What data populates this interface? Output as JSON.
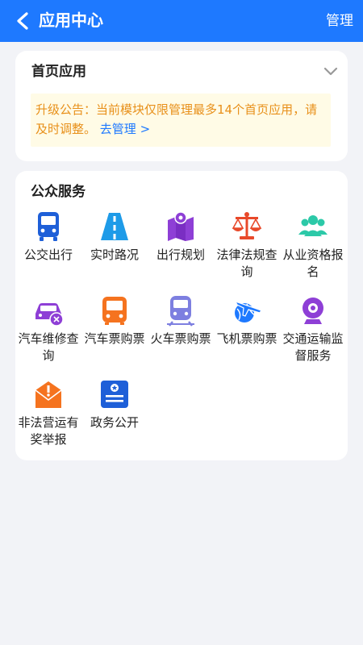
{
  "header": {
    "title": "应用中心",
    "manage_label": "管理"
  },
  "home_apps": {
    "title": "首页应用",
    "notice_text": "升级公告：当前模块仅限管理最多14个首页应用，请及时调整。",
    "notice_link": "去管理 >"
  },
  "public_services": {
    "title": "公众服务",
    "apps": [
      {
        "label": "公交出行",
        "icon": "bus-icon"
      },
      {
        "label": "实时路况",
        "icon": "road-icon"
      },
      {
        "label": "出行规划",
        "icon": "map-pin-icon"
      },
      {
        "label": "法律法规查询",
        "icon": "scales-icon"
      },
      {
        "label": "从业资格报名",
        "icon": "users-icon"
      },
      {
        "label": "汽车维修查询",
        "icon": "car-repair-icon"
      },
      {
        "label": "汽车票购票",
        "icon": "coach-icon"
      },
      {
        "label": "火车票购票",
        "icon": "train-icon"
      },
      {
        "label": "飞机票购票",
        "icon": "plane-icon"
      },
      {
        "label": "交通运输监督服务",
        "icon": "camera-icon"
      },
      {
        "label": "非法营运有奖举报",
        "icon": "report-icon"
      },
      {
        "label": "政务公开",
        "icon": "gov-icon"
      }
    ]
  },
  "colors": {
    "primary": "#1e79ff",
    "notice_bg": "#fffbe6",
    "notice_text": "#e8901a",
    "page_bg": "#f2f3f7"
  }
}
